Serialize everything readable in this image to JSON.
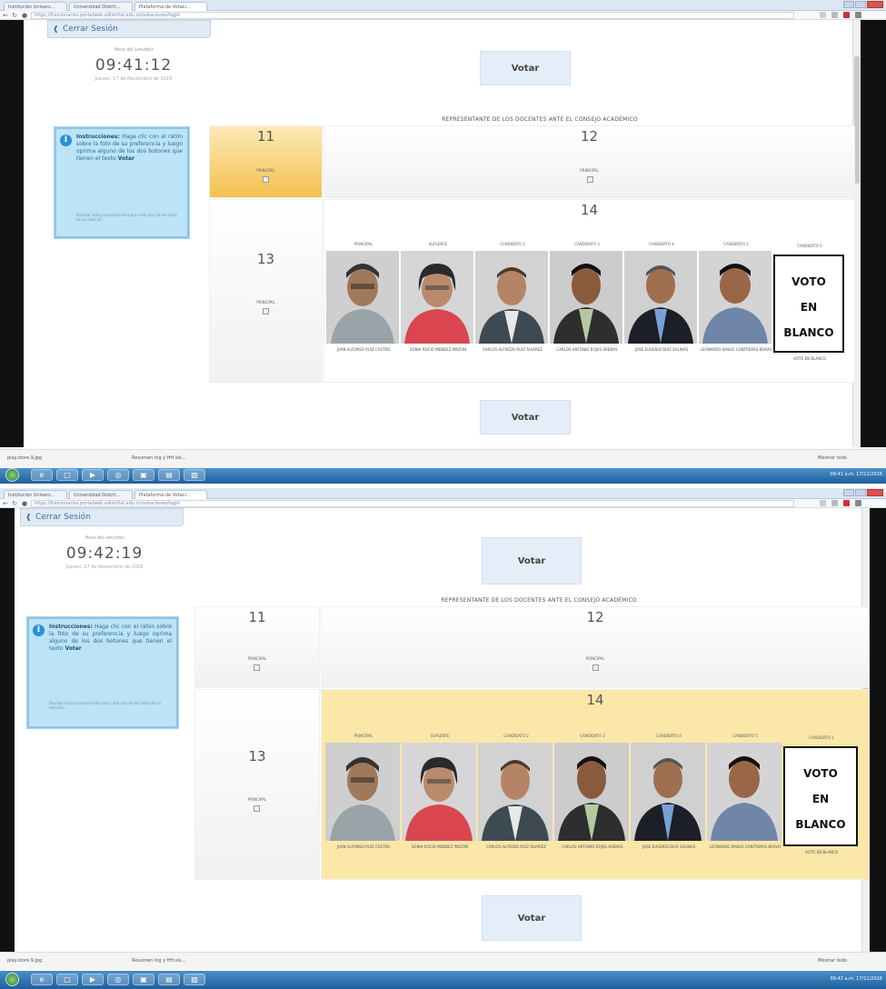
{
  "shots": [
    {
      "tabs": [
        "Institución Univers...",
        "Universidad Distrit...",
        "Plataforma de Votaci..."
      ],
      "url": "https://funcionarios.portalweb.udistrital.edu.co/votaciones/login",
      "cerrar": "Cerrar Sesión",
      "hora_label": "Hora del servidor",
      "time": "09:41:12",
      "date": "Jueves, 17 de Noviembre de 2016",
      "instructions": {
        "title": "Instrucciones:",
        "text": "Haga clic con el ratón sobre la foto de su preferencia y luego oprima alguno de los dos botones que tienen el texto",
        "bold": "Votar",
        "small": "Realizar esta procedimiento para cada una de las listas de su elección."
      },
      "votar_top": "Votar",
      "votar_bottom": "Votar",
      "heading": "REPRESENTANTE DE LOS DOCENTES ANTE EL CONSEJO ACADÉMICO",
      "n11": "11",
      "n12": "12",
      "n13": "13",
      "n14": "14",
      "principal": "PRINCIPAL",
      "blanco_lines": [
        "VOTO",
        "EN",
        "BLANCO"
      ],
      "cands": [
        {
          "role": "PRINCIPAL",
          "name": "JUAN ALFONSO RUIZ CASTRO"
        },
        {
          "role": "SUPLENTE",
          "name": "SONIA ROCIO MENDEZ PINZON"
        },
        {
          "role": "CANDIDATO 2",
          "name": "CARLOS ALFREDO RUIZ ÁLVAREZ"
        },
        {
          "role": "CANDIDATO 3",
          "name": "CARLOS ANTONIO ROJAS ARENAS"
        },
        {
          "role": "CANDIDATO 4",
          "name": "JOSE EUGENIO DIAZ SALINAS"
        },
        {
          "role": "CANDIDATO 5",
          "name": "LEONARDO EMILIO CONTRERAS BRAVO"
        }
      ],
      "blanco_role": "CANDIDATO 1",
      "blanco_name": "VOTO EN BLANCO",
      "download": "play.store.9.jpg",
      "download2": "Resumen ing y HH.xls...",
      "show_all": "Mostrar todo",
      "tray": "09:41 a.m. 17/11/2016"
    },
    {
      "tabs": [
        "Institución Univers...",
        "Universidad Distrit...",
        "Plataforma de Votaci..."
      ],
      "url": "https://funcionarios.portalweb.udistrital.edu.co/votaciones/login",
      "cerrar": "Cerrar Sesión",
      "hora_label": "Hora del servidor",
      "time": "09:42:19",
      "date": "Jueves, 17 de Noviembre de 2016",
      "instructions": {
        "title": "Instrucciones:",
        "text": "Haga clic con el ratón sobre la foto de su preferencia y luego oprima alguno de los dos botones que tienen el texto",
        "bold": "Votar",
        "small": "Realizar esta procedimiento para cada una de las listas de su elección."
      },
      "votar_top": "Votar",
      "votar_bottom": "Votar",
      "heading": "REPRESENTANTE DE LOS DOCENTES ANTE EL CONSEJO ACADÉMICO",
      "n11": "11",
      "n12": "12",
      "n13": "13",
      "n14": "14",
      "principal": "PRINCIPAL",
      "blanco_lines": [
        "VOTO",
        "EN",
        "BLANCO"
      ],
      "cands": [
        {
          "role": "PRINCIPAL",
          "name": "JUAN ALFONSO RUIZ CASTRO"
        },
        {
          "role": "SUPLENTE",
          "name": "SONIA ROCIO MENDEZ PINZON"
        },
        {
          "role": "CANDIDATO 2",
          "name": "CARLOS ALFREDO RUIZ ÁLVAREZ"
        },
        {
          "role": "CANDIDATO 3",
          "name": "CARLOS ANTONIO ROJAS ARENAS"
        },
        {
          "role": "CANDIDATO 4",
          "name": "JOSE EUGENIO DIAZ SALINAS"
        },
        {
          "role": "CANDIDATO 5",
          "name": "LEONARDO EMILIO CONTRERAS BRAVO"
        }
      ],
      "blanco_role": "CANDIDATO 1",
      "blanco_name": "VOTO EN BLANCO",
      "download": "play.store.9.jpg",
      "download2": "Resumen ing y HH.xls...",
      "show_all": "Mostrar todo",
      "tray": "09:42 a.m. 17/11/2016"
    }
  ],
  "colors": {
    "selected_gold": "#f4c14f",
    "selected_yellow": "#fbe7a8",
    "accent_blue": "#3a6ea5",
    "info_bg": "#bde3f7"
  }
}
